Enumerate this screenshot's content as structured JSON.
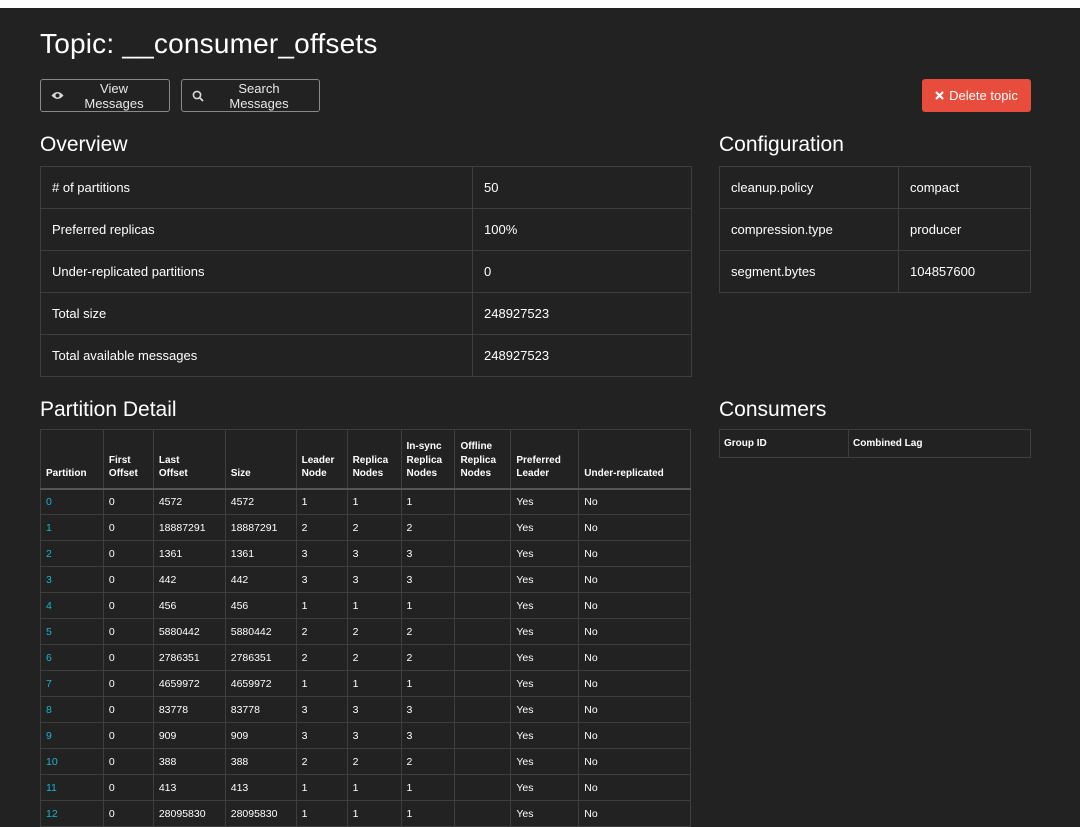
{
  "page": {
    "title": "Topic: __consumer_offsets",
    "view_messages_label": "View Messages",
    "search_messages_label": "Search Messages",
    "delete_topic_label": "Delete topic"
  },
  "overview": {
    "heading": "Overview",
    "rows": [
      {
        "key": "# of partitions",
        "value": "50"
      },
      {
        "key": "Preferred replicas",
        "value": "100%"
      },
      {
        "key": "Under-replicated partitions",
        "value": "0"
      },
      {
        "key": "Total size",
        "value": "248927523"
      },
      {
        "key": "Total available messages",
        "value": "248927523"
      }
    ]
  },
  "configuration": {
    "heading": "Configuration",
    "rows": [
      {
        "key": "cleanup.policy",
        "value": "compact"
      },
      {
        "key": "compression.type",
        "value": "producer"
      },
      {
        "key": "segment.bytes",
        "value": "104857600"
      }
    ]
  },
  "consumers": {
    "heading": "Consumers",
    "columns": [
      "Group ID",
      "Combined Lag"
    ]
  },
  "partition_detail": {
    "heading": "Partition Detail",
    "columns": [
      [
        "Partition"
      ],
      [
        "First",
        "Offset"
      ],
      [
        "Last",
        "Offset"
      ],
      [
        "Size"
      ],
      [
        "Leader",
        "Node"
      ],
      [
        "Replica",
        "Nodes"
      ],
      [
        "In-sync",
        "Replica",
        "Nodes"
      ],
      [
        "Offline",
        "Replica",
        "Nodes"
      ],
      [
        "Preferred",
        "Leader"
      ],
      [
        "Under-replicated"
      ]
    ],
    "rows": [
      [
        "0",
        "0",
        "4572",
        "4572",
        "1",
        "1",
        "1",
        "",
        "Yes",
        "No"
      ],
      [
        "1",
        "0",
        "18887291",
        "18887291",
        "2",
        "2",
        "2",
        "",
        "Yes",
        "No"
      ],
      [
        "2",
        "0",
        "1361",
        "1361",
        "3",
        "3",
        "3",
        "",
        "Yes",
        "No"
      ],
      [
        "3",
        "0",
        "442",
        "442",
        "3",
        "3",
        "3",
        "",
        "Yes",
        "No"
      ],
      [
        "4",
        "0",
        "456",
        "456",
        "1",
        "1",
        "1",
        "",
        "Yes",
        "No"
      ],
      [
        "5",
        "0",
        "5880442",
        "5880442",
        "2",
        "2",
        "2",
        "",
        "Yes",
        "No"
      ],
      [
        "6",
        "0",
        "2786351",
        "2786351",
        "2",
        "2",
        "2",
        "",
        "Yes",
        "No"
      ],
      [
        "7",
        "0",
        "4659972",
        "4659972",
        "1",
        "1",
        "1",
        "",
        "Yes",
        "No"
      ],
      [
        "8",
        "0",
        "83778",
        "83778",
        "3",
        "3",
        "3",
        "",
        "Yes",
        "No"
      ],
      [
        "9",
        "0",
        "909",
        "909",
        "3",
        "3",
        "3",
        "",
        "Yes",
        "No"
      ],
      [
        "10",
        "0",
        "388",
        "388",
        "2",
        "2",
        "2",
        "",
        "Yes",
        "No"
      ],
      [
        "11",
        "0",
        "413",
        "413",
        "1",
        "1",
        "1",
        "",
        "Yes",
        "No"
      ],
      [
        "12",
        "0",
        "28095830",
        "28095830",
        "1",
        "1",
        "1",
        "",
        "Yes",
        "No"
      ]
    ]
  },
  "icons": {
    "view": "eye-icon",
    "search": "search-icon",
    "delete": "close-icon"
  },
  "colors": {
    "background": "#222222",
    "link": "#17b6d3",
    "danger": "#e74c3c",
    "border": "#3e3e3e"
  }
}
